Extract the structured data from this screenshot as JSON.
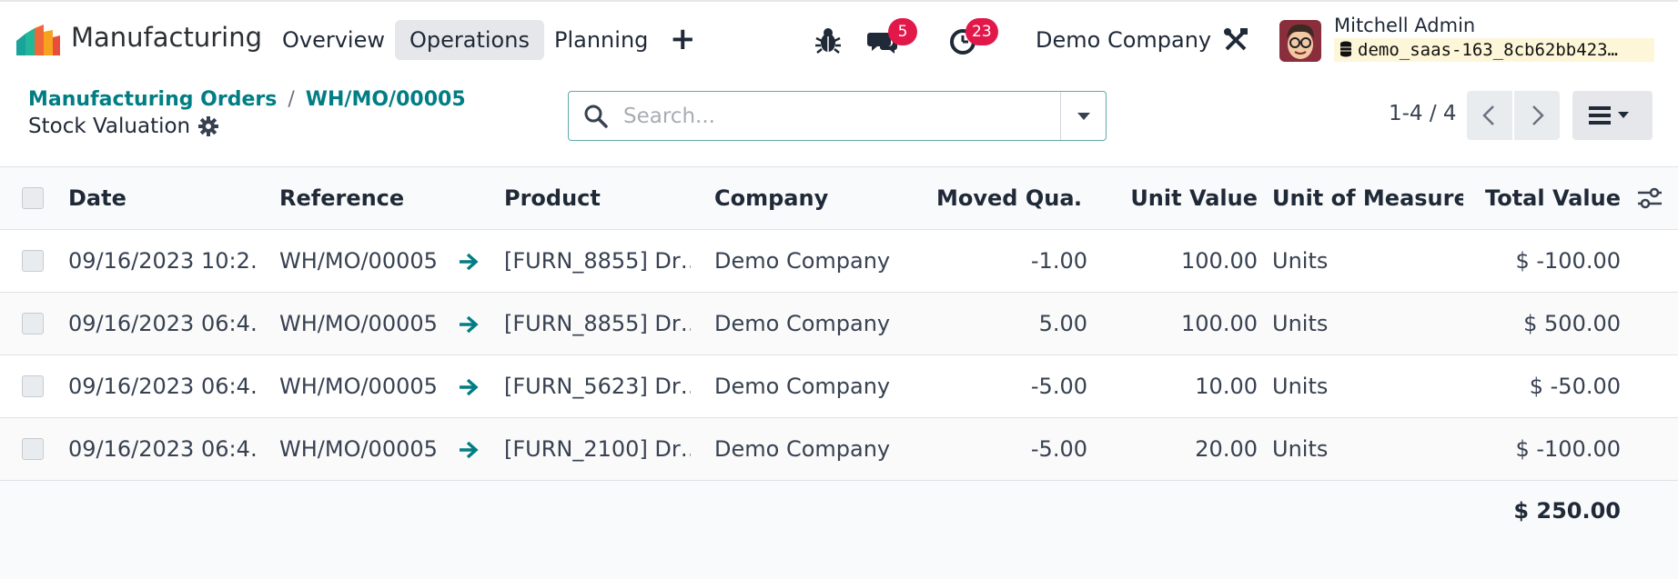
{
  "nav": {
    "app_name": "Manufacturing",
    "menus": [
      "Overview",
      "Operations",
      "Planning"
    ],
    "active_menu": "Operations",
    "messages_count": "5",
    "activities_count": "23",
    "company": "Demo Company",
    "user_name": "Mitchell Admin",
    "database": "demo_saas-163_8cb62bb423…"
  },
  "control": {
    "breadcrumb": [
      "Manufacturing Orders",
      "WH/MO/00005"
    ],
    "breadcrumb_separator": "/",
    "title": "Stock Valuation",
    "search_placeholder": "Search...",
    "pager": "1-4 / 4"
  },
  "table": {
    "columns": [
      "Date",
      "Reference",
      "Product",
      "Company",
      "Moved Qua…",
      "Unit Value",
      "Unit of Measure",
      "Total Value"
    ],
    "rows": [
      {
        "date": "09/16/2023 10:2…",
        "reference": "WH/MO/00005",
        "product": "[FURN_8855] Dr…",
        "company": "Demo Company",
        "moved_qty": "-1.00",
        "unit_value": "100.00",
        "uom": "Units",
        "total_value": "$ -100.00"
      },
      {
        "date": "09/16/2023 06:4…",
        "reference": "WH/MO/00005",
        "product": "[FURN_8855] Dr…",
        "company": "Demo Company",
        "moved_qty": "5.00",
        "unit_value": "100.00",
        "uom": "Units",
        "total_value": "$ 500.00"
      },
      {
        "date": "09/16/2023 06:4…",
        "reference": "WH/MO/00005",
        "product": "[FURN_5623] Dr…",
        "company": "Demo Company",
        "moved_qty": "-5.00",
        "unit_value": "10.00",
        "uom": "Units",
        "total_value": "$ -50.00"
      },
      {
        "date": "09/16/2023 06:4…",
        "reference": "WH/MO/00005",
        "product": "[FURN_2100] Dr…",
        "company": "Demo Company",
        "moved_qty": "-5.00",
        "unit_value": "20.00",
        "uom": "Units",
        "total_value": "$ -100.00"
      }
    ],
    "total": "$ 250.00"
  },
  "colors": {
    "accent": "#017e84",
    "badge": "#e3184a"
  }
}
